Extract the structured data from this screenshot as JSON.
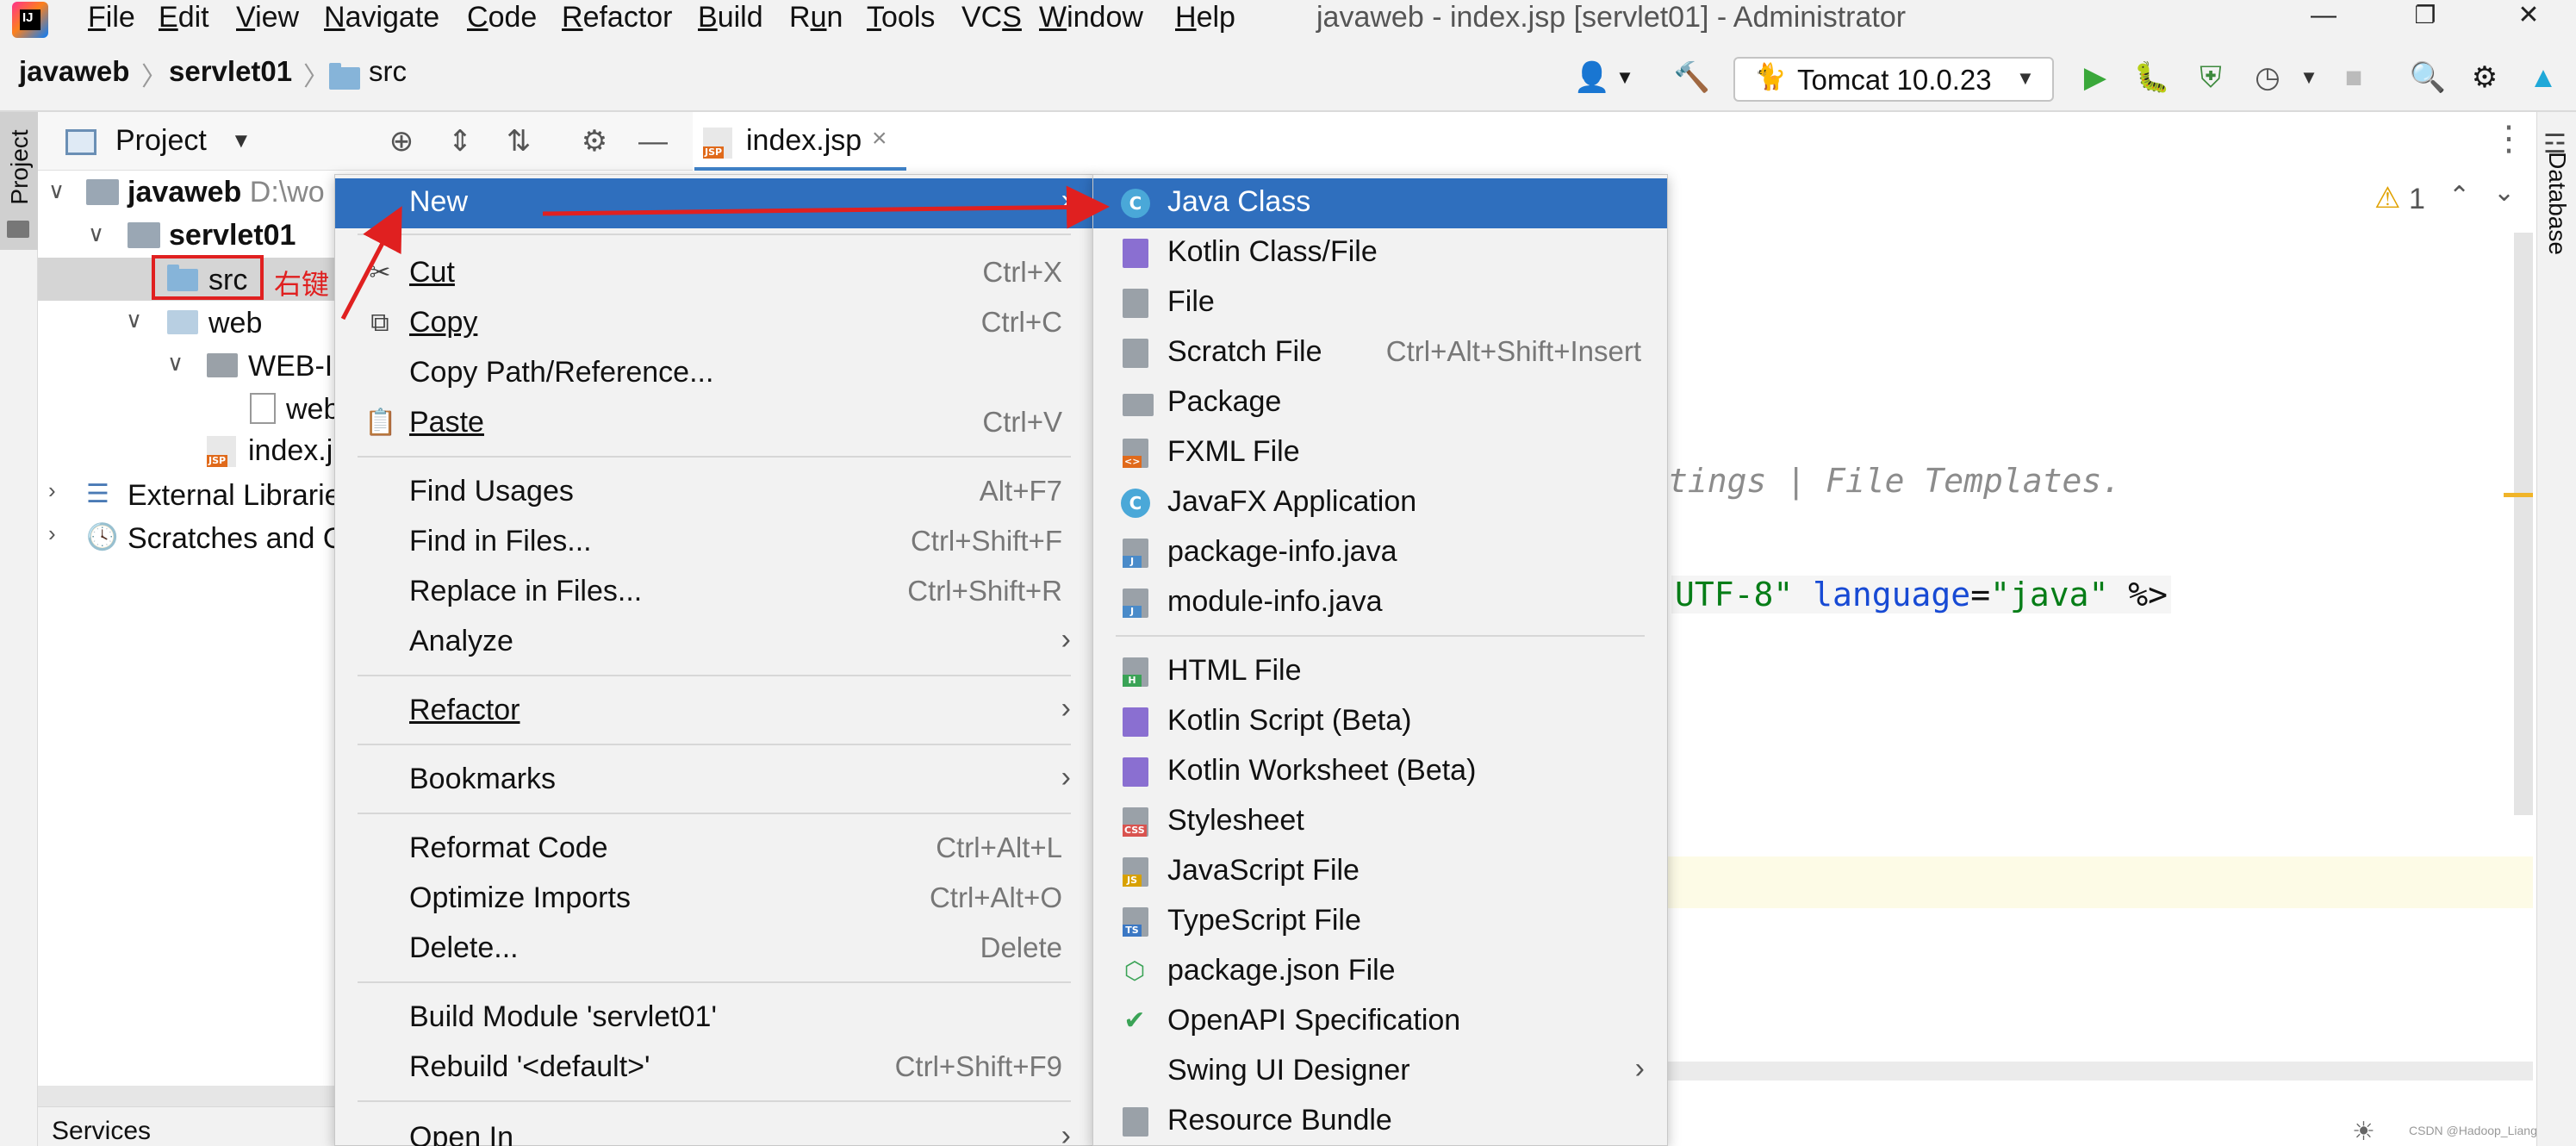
{
  "menubar": {
    "items": [
      {
        "label": "File",
        "u": "F"
      },
      {
        "label": "Edit",
        "u": "E"
      },
      {
        "label": "View",
        "u": "V"
      },
      {
        "label": "Navigate",
        "u": "N"
      },
      {
        "label": "Code",
        "u": "C"
      },
      {
        "label": "Refactor",
        "u": "R"
      },
      {
        "label": "Build",
        "u": "B"
      },
      {
        "label": "Run",
        "u": "u"
      },
      {
        "label": "Tools",
        "u": "T"
      },
      {
        "label": "VCS",
        "u": "S"
      },
      {
        "label": "Window",
        "u": "W"
      },
      {
        "label": "Help",
        "u": "H"
      }
    ],
    "window_title": "javaweb - index.jsp [servlet01] - Administrator",
    "logo_text": "IJ"
  },
  "navbar": {
    "crumbs": [
      "javaweb",
      "servlet01",
      "src"
    ],
    "run_config": "Tomcat 10.0.23"
  },
  "left_strip": {
    "project_label": "Project"
  },
  "right_strip": {
    "database_label": "Database"
  },
  "project": {
    "title": "Project",
    "tree": {
      "javaweb": "javaweb",
      "javaweb_path": "D:\\wo",
      "servlet01": "servlet01",
      "src": "src",
      "web": "web",
      "web_inf": "WEB-II",
      "web_xml": "web",
      "index_jsp": "index.j",
      "external_libraries": "External Librarie",
      "scratches": "Scratches and C"
    },
    "annotation": "右键",
    "services": "Services"
  },
  "editor": {
    "tab_label": "index.jsp",
    "warning_count": "1",
    "line_comment": "tings | File Templates.",
    "line_directive": {
      "p1": "UTF-8\"",
      "p2": " language",
      "p3": "=",
      "p4": "\"java\"",
      "p5": " %>"
    }
  },
  "context_menu": {
    "new": "New",
    "cut": "Cut",
    "cut_sc": "Ctrl+X",
    "copy": "Copy",
    "copy_sc": "Ctrl+C",
    "copy_path": "Copy Path/Reference...",
    "paste": "Paste",
    "paste_sc": "Ctrl+V",
    "find_usages": "Find Usages",
    "find_usages_sc": "Alt+F7",
    "find_in_files": "Find in Files...",
    "find_in_files_sc": "Ctrl+Shift+F",
    "replace_in_files": "Replace in Files...",
    "replace_in_files_sc": "Ctrl+Shift+R",
    "analyze": "Analyze",
    "refactor": "Refactor",
    "bookmarks": "Bookmarks",
    "reformat_code": "Reformat Code",
    "reformat_code_sc": "Ctrl+Alt+L",
    "optimize_imports": "Optimize Imports",
    "optimize_imports_sc": "Ctrl+Alt+O",
    "delete": "Delete...",
    "delete_sc": "Delete",
    "build_module": "Build Module 'servlet01'",
    "rebuild": "Rebuild '<default>'",
    "rebuild_sc": "Ctrl+Shift+F9",
    "open_in": "Open In"
  },
  "new_submenu": {
    "java_class": "Java Class",
    "kotlin_class": "Kotlin Class/File",
    "file": "File",
    "scratch_file": "Scratch File",
    "scratch_file_sc": "Ctrl+Alt+Shift+Insert",
    "package": "Package",
    "fxml_file": "FXML File",
    "javafx_app": "JavaFX Application",
    "package_info": "package-info.java",
    "module_info": "module-info.java",
    "html_file": "HTML File",
    "kotlin_script": "Kotlin Script (Beta)",
    "kotlin_worksheet": "Kotlin Worksheet (Beta)",
    "stylesheet": "Stylesheet",
    "javascript_file": "JavaScript File",
    "typescript_file": "TypeScript File",
    "package_json": "package.json File",
    "openapi": "OpenAPI Specification",
    "swing_ui": "Swing UI Designer",
    "resource_bundle": "Resource Bundle"
  },
  "badges": {
    "jsp": "JSP",
    "html": "H",
    "css": "CSS",
    "js": "JS",
    "ts": "TS",
    "java": "J",
    "fxml": "<>",
    "class": "C"
  },
  "watermark": "CSDN @Hadoop_Liang",
  "colors": {
    "selection": "#2f6fbe",
    "annotation_red": "#e02020",
    "menu_bg": "#f2f2f2",
    "keyword_blue": "#0033b3",
    "string_green": "#067d17"
  }
}
